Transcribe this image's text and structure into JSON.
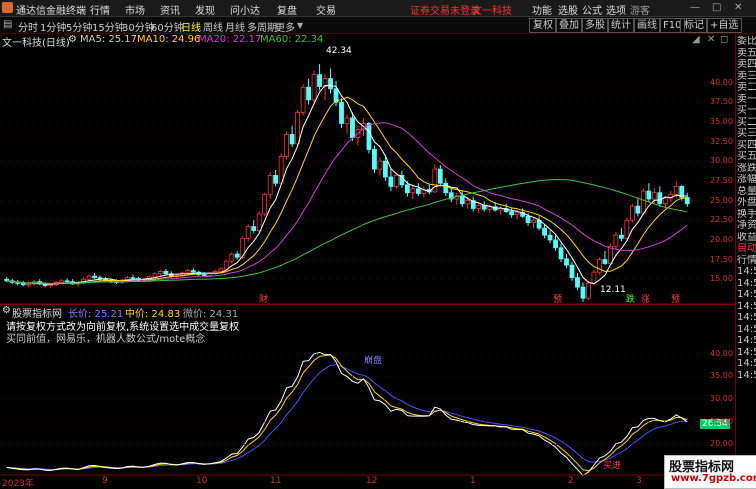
{
  "app": {
    "name": "通达信金融终端",
    "menu": [
      "行情",
      "市场",
      "资讯",
      "发现",
      "问小达",
      "复盘",
      "交易"
    ],
    "notice": "证券交易未登录",
    "notice_stock": "文一科技",
    "right_menu": [
      "功能",
      "选股",
      "公式",
      "选项",
      "游客"
    ]
  },
  "periods": [
    "分时",
    "1分钟",
    "5分钟",
    "15分钟",
    "30分钟",
    "60分钟",
    "日线",
    "周线",
    "月线",
    "多周期",
    "更多"
  ],
  "active_period": "日线",
  "toolbar": [
    "复权",
    "叠加",
    "多股",
    "统计",
    "画线",
    "F10",
    "标记",
    "+自选"
  ],
  "stock_title": "文一科技(日线)",
  "ma": [
    {
      "label": "MA5: 25.17",
      "color": "#ffffff"
    },
    {
      "label": "MA10: 24.96",
      "color": "#ffd700"
    },
    {
      "label": "MA20: 22.17",
      "color": "#d040d0"
    },
    {
      "label": "MA60: 22.34",
      "color": "#40c040"
    }
  ],
  "right_panel": [
    "委比",
    "卖五",
    "卖四",
    "卖三",
    "卖二",
    "卖一",
    "买一",
    "买二",
    "买三",
    "买四",
    "买五",
    "涨跌",
    "涨幅",
    "总量",
    "外盘",
    "换手",
    "净资",
    "收益",
    "自动",
    "行情",
    "14:50",
    "14:50",
    "14:50",
    "14:50",
    "14:50",
    "14:50",
    "14:50",
    "14:50",
    "14:50",
    "14:50"
  ],
  "price_axis": [
    "40.00",
    "37.50",
    "35.00",
    "32.50",
    "30.00",
    "27.50",
    "25.00",
    "22.50",
    "20.00",
    "17.50",
    "15.00"
  ],
  "high_label": "42.34",
  "low_label": "12.11",
  "event_labels": [
    {
      "text": "财",
      "color": "#ff4040"
    },
    {
      "text": "预",
      "color": "#ff4040"
    },
    {
      "text": "跌",
      "color": "#40ff40"
    },
    {
      "text": "涨",
      "color": "#ff4040"
    },
    {
      "text": "预",
      "color": "#ff4040"
    }
  ],
  "indicator": {
    "name": "股票指标网",
    "long": "长价: 25.21",
    "mid": "中价: 24.83",
    "short": "微价: 24.31",
    "desc1": "请按复权方式改为向前复权,系统设置选中成交量复权",
    "desc2": "买同前值，网易乐，机器人数公式/mote概念",
    "label_peak": "崩盘",
    "label_bottom": "买进",
    "current_value": "26.54",
    "axis": [
      "40.00",
      "35.00",
      "30.00",
      "25.00",
      "20.00"
    ]
  },
  "x_axis": [
    "2023年",
    "9",
    "10",
    "11",
    "12",
    "1",
    "2",
    "3"
  ],
  "watermark": {
    "line1": "股票指标网",
    "line2": "www.7gpzb.com"
  },
  "chart_data": {
    "type": "candlestick",
    "title": "文一科技(日线)",
    "ylim": [
      13,
      43.5
    ],
    "x": [
      "2023年",
      "9",
      "10",
      "11",
      "12",
      "1",
      "2",
      "3"
    ],
    "ohlc": [
      [
        15.0,
        15.3,
        14.6,
        14.8
      ],
      [
        14.8,
        15.1,
        14.4,
        14.6
      ],
      [
        14.6,
        14.9,
        14.2,
        14.5
      ],
      [
        14.5,
        14.8,
        14.1,
        14.3
      ],
      [
        14.3,
        14.7,
        14.0,
        14.4
      ],
      [
        14.4,
        14.9,
        14.2,
        14.7
      ],
      [
        14.7,
        15.0,
        14.3,
        14.4
      ],
      [
        14.4,
        14.6,
        14.0,
        14.2
      ],
      [
        14.2,
        14.5,
        13.9,
        14.3
      ],
      [
        14.3,
        14.8,
        14.1,
        14.6
      ],
      [
        14.6,
        15.0,
        14.4,
        14.8
      ],
      [
        14.8,
        15.1,
        14.5,
        14.7
      ],
      [
        14.7,
        15.0,
        14.3,
        14.4
      ],
      [
        14.4,
        14.7,
        14.1,
        14.5
      ],
      [
        14.5,
        15.2,
        14.4,
        15.0
      ],
      [
        15.0,
        15.6,
        14.8,
        15.4
      ],
      [
        15.4,
        15.8,
        15.0,
        15.2
      ],
      [
        15.2,
        15.5,
        14.8,
        15.0
      ],
      [
        15.0,
        15.3,
        14.6,
        14.8
      ],
      [
        14.8,
        15.1,
        14.5,
        14.7
      ],
      [
        14.7,
        15.0,
        14.4,
        14.6
      ],
      [
        14.6,
        15.0,
        14.4,
        14.9
      ],
      [
        14.9,
        15.4,
        14.7,
        15.2
      ],
      [
        15.2,
        15.6,
        14.9,
        15.1
      ],
      [
        15.1,
        15.3,
        14.7,
        14.9
      ],
      [
        14.9,
        15.2,
        14.6,
        15.0
      ],
      [
        15.0,
        15.5,
        14.8,
        15.3
      ],
      [
        15.3,
        15.9,
        15.1,
        15.7
      ],
      [
        15.7,
        16.2,
        15.4,
        16.0
      ],
      [
        16.0,
        16.3,
        15.5,
        15.7
      ],
      [
        15.7,
        16.0,
        15.2,
        15.4
      ],
      [
        15.4,
        15.7,
        15.1,
        15.5
      ],
      [
        15.5,
        16.0,
        15.3,
        15.8
      ],
      [
        15.8,
        16.3,
        15.6,
        16.1
      ],
      [
        16.1,
        16.4,
        15.7,
        15.9
      ],
      [
        15.9,
        16.1,
        15.4,
        15.6
      ],
      [
        15.6,
        15.9,
        15.3,
        15.5
      ],
      [
        15.5,
        15.9,
        15.4,
        15.8
      ],
      [
        15.8,
        16.2,
        15.6,
        16.0
      ],
      [
        16.0,
        16.5,
        15.8,
        16.3
      ],
      [
        16.3,
        17.5,
        16.1,
        17.3
      ],
      [
        17.3,
        18.4,
        17.0,
        18.2
      ],
      [
        18.2,
        18.6,
        17.5,
        17.8
      ],
      [
        17.8,
        20.5,
        17.6,
        20.2
      ],
      [
        20.2,
        22.0,
        19.8,
        21.7
      ],
      [
        21.7,
        22.5,
        20.9,
        21.2
      ],
      [
        21.2,
        23.6,
        21.0,
        23.3
      ],
      [
        23.3,
        26.0,
        23.0,
        25.8
      ],
      [
        25.8,
        28.6,
        25.2,
        28.2
      ],
      [
        28.2,
        28.9,
        26.8,
        27.2
      ],
      [
        27.2,
        31.0,
        27.0,
        30.6
      ],
      [
        30.6,
        33.8,
        30.2,
        33.4
      ],
      [
        33.4,
        34.5,
        31.8,
        32.2
      ],
      [
        32.2,
        36.5,
        32.0,
        36.2
      ],
      [
        36.2,
        39.8,
        35.8,
        39.4
      ],
      [
        39.4,
        40.5,
        37.2,
        37.8
      ],
      [
        37.8,
        41.5,
        37.5,
        41.0
      ],
      [
        41.0,
        42.34,
        39.0,
        39.5
      ],
      [
        39.5,
        41.0,
        37.8,
        40.5
      ],
      [
        40.5,
        41.8,
        38.6,
        39.2
      ],
      [
        39.2,
        40.2,
        37.0,
        37.5
      ],
      [
        37.5,
        38.0,
        34.2,
        34.8
      ],
      [
        34.8,
        36.0,
        33.5,
        35.5
      ],
      [
        35.5,
        36.2,
        32.6,
        33.0
      ],
      [
        33.0,
        34.5,
        32.0,
        34.0
      ],
      [
        34.0,
        35.5,
        33.2,
        34.8
      ],
      [
        34.8,
        35.0,
        31.0,
        31.5
      ],
      [
        31.5,
        32.0,
        28.5,
        29.0
      ],
      [
        29.0,
        30.5,
        28.2,
        30.0
      ],
      [
        30.0,
        30.8,
        27.5,
        28.0
      ],
      [
        28.0,
        29.0,
        26.2,
        26.8
      ],
      [
        26.8,
        28.5,
        26.5,
        28.2
      ],
      [
        28.2,
        28.8,
        26.6,
        27.0
      ],
      [
        27.0,
        27.5,
        25.5,
        26.0
      ],
      [
        26.0,
        27.0,
        25.2,
        26.5
      ],
      [
        26.5,
        27.2,
        25.6,
        25.9
      ],
      [
        25.9,
        26.8,
        25.4,
        26.4
      ],
      [
        26.4,
        27.0,
        25.8,
        26.1
      ],
      [
        26.1,
        29.6,
        26.0,
        29.0
      ],
      [
        29.0,
        29.5,
        26.8,
        27.2
      ],
      [
        27.2,
        27.8,
        25.6,
        26.0
      ],
      [
        26.0,
        26.6,
        24.8,
        25.2
      ],
      [
        25.2,
        26.0,
        24.5,
        25.6
      ],
      [
        25.6,
        26.2,
        24.2,
        24.6
      ],
      [
        24.6,
        25.5,
        24.0,
        25.0
      ],
      [
        25.0,
        25.5,
        23.6,
        24.0
      ],
      [
        24.0,
        24.8,
        23.4,
        24.4
      ],
      [
        24.4,
        24.9,
        23.6,
        23.9
      ],
      [
        23.9,
        24.5,
        23.5,
        24.2
      ],
      [
        24.2,
        24.8,
        23.6,
        23.8
      ],
      [
        23.8,
        24.3,
        23.2,
        24.0
      ],
      [
        24.0,
        24.6,
        23.4,
        23.6
      ],
      [
        23.6,
        24.0,
        22.8,
        23.2
      ],
      [
        23.2,
        23.8,
        22.6,
        23.5
      ],
      [
        23.5,
        24.0,
        22.8,
        23.0
      ],
      [
        23.0,
        23.4,
        21.8,
        22.2
      ],
      [
        22.2,
        22.8,
        21.5,
        22.5
      ],
      [
        22.5,
        23.0,
        21.2,
        21.5
      ],
      [
        21.5,
        22.0,
        20.2,
        20.6
      ],
      [
        20.6,
        21.2,
        19.6,
        20.0
      ],
      [
        20.0,
        20.6,
        18.6,
        19.0
      ],
      [
        19.0,
        19.5,
        17.2,
        17.6
      ],
      [
        17.6,
        18.2,
        16.4,
        16.8
      ],
      [
        16.8,
        17.2,
        14.8,
        15.2
      ],
      [
        15.2,
        15.8,
        13.6,
        14.0
      ],
      [
        14.0,
        14.6,
        12.11,
        12.6
      ],
      [
        12.6,
        14.8,
        12.4,
        14.5
      ],
      [
        14.5,
        16.2,
        14.2,
        15.9
      ],
      [
        15.9,
        17.8,
        15.6,
        17.5
      ],
      [
        17.5,
        18.6,
        16.8,
        17.0
      ],
      [
        17.0,
        19.5,
        16.8,
        19.2
      ],
      [
        19.2,
        21.0,
        18.8,
        20.6
      ],
      [
        20.6,
        21.5,
        19.8,
        20.2
      ],
      [
        20.2,
        22.8,
        20.0,
        22.5
      ],
      [
        22.5,
        24.6,
        22.2,
        24.3
      ],
      [
        24.3,
        25.2,
        23.0,
        23.4
      ],
      [
        23.4,
        26.5,
        23.2,
        26.2
      ],
      [
        26.2,
        27.2,
        24.8,
        25.2
      ],
      [
        25.2,
        26.6,
        24.6,
        26.0
      ],
      [
        26.0,
        26.8,
        24.2,
        24.6
      ],
      [
        24.6,
        25.6,
        24.0,
        25.3
      ],
      [
        25.3,
        26.2,
        24.8,
        25.8
      ],
      [
        25.8,
        27.4,
        25.4,
        26.8
      ],
      [
        26.8,
        27.0,
        25.0,
        25.4
      ],
      [
        25.4,
        26.0,
        24.2,
        24.6
      ]
    ],
    "indicator_series": [
      {
        "name": "长价",
        "color": "#5050ff"
      },
      {
        "name": "中价",
        "color": "#ffd700"
      },
      {
        "name": "微价",
        "color": "#ffffff"
      }
    ]
  }
}
